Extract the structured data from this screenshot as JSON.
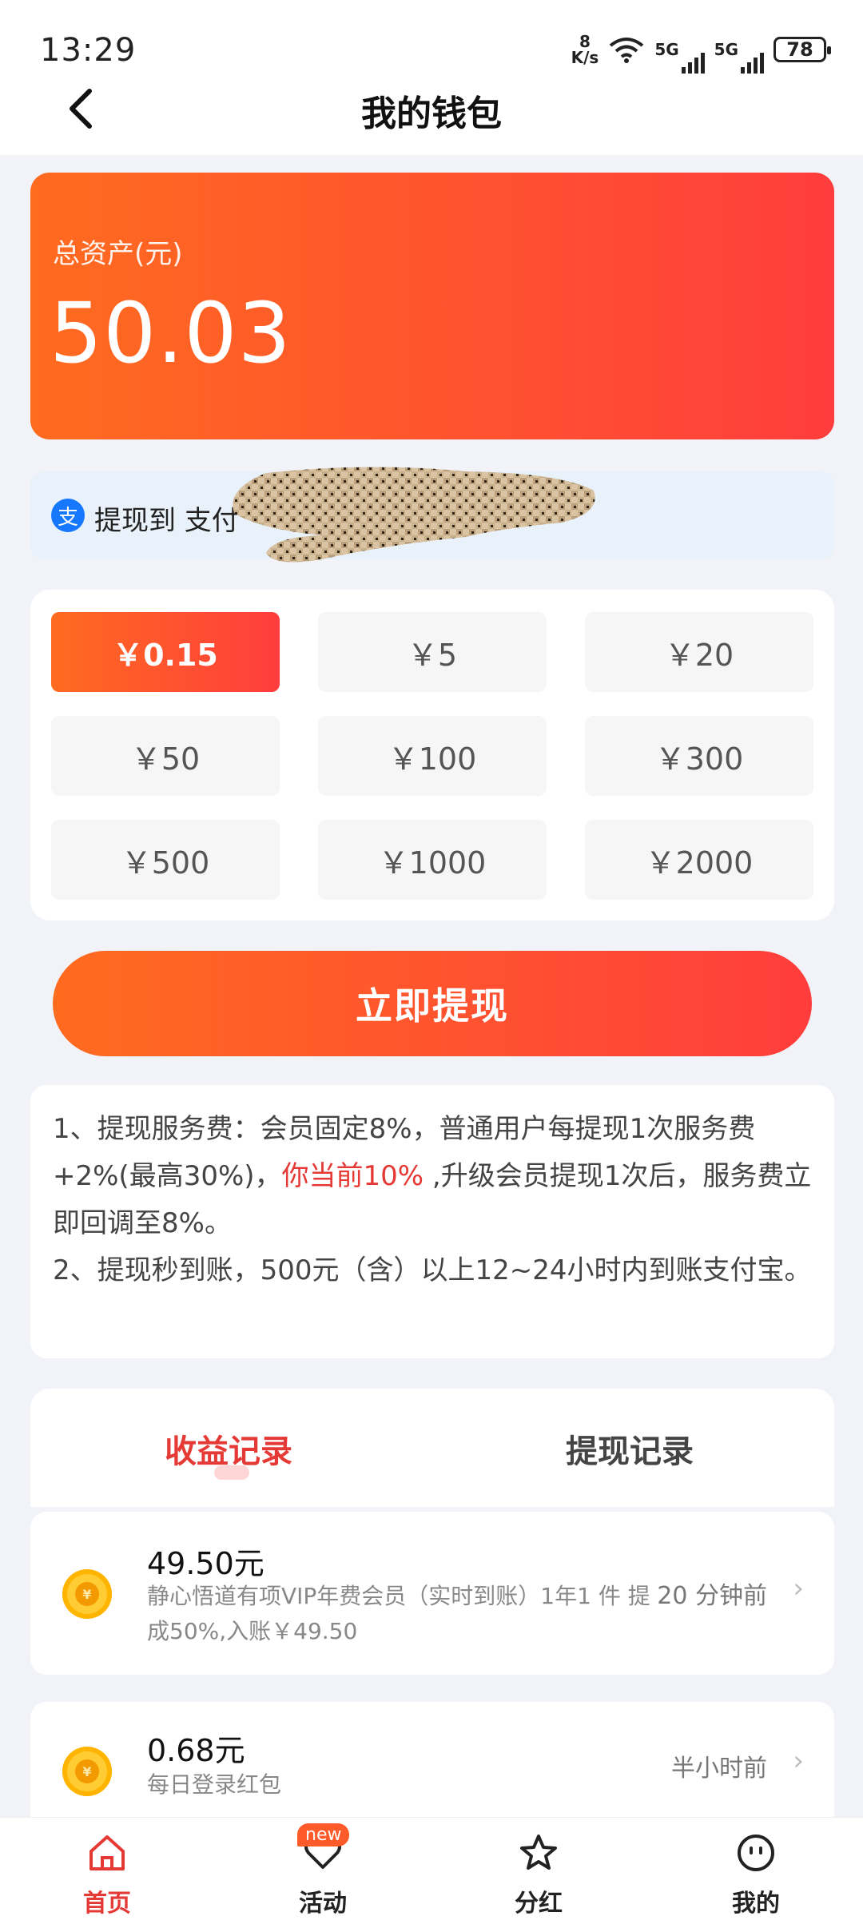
{
  "status": {
    "time": "13:29",
    "net_speed_value": "8",
    "net_speed_unit": "K/s",
    "sig1": "5G",
    "sig2": "5G",
    "battery": "78"
  },
  "header": {
    "title": "我的钱包"
  },
  "asset": {
    "label": "总资产(元)",
    "value": "50.03"
  },
  "withdraw_to": {
    "label": "提现到 支付"
  },
  "amounts": [
    {
      "label": "￥0.15",
      "selected": true
    },
    {
      "label": "￥5",
      "selected": false
    },
    {
      "label": "￥20",
      "selected": false
    },
    {
      "label": "￥50",
      "selected": false
    },
    {
      "label": "￥100",
      "selected": false
    },
    {
      "label": "￥300",
      "selected": false
    },
    {
      "label": "￥500",
      "selected": false
    },
    {
      "label": "￥1000",
      "selected": false
    },
    {
      "label": "￥2000",
      "selected": false
    }
  ],
  "withdraw_button": "立即提现",
  "notes": {
    "line1_a": "1、提现服务费：会员固定8%，普通用户每提现1次服务费+2%(最高30%)，",
    "line1_highlight": "你当前10%",
    "line1_b": " ,升级会员提现1次后，服务费立即回调至8%。",
    "line2": "2、提现秒到账，500元（含）以上12~24小时内到账支付宝。"
  },
  "tabs": {
    "income": "收益记录",
    "withdraw": "提现记录"
  },
  "records": [
    {
      "amount": "49.50元",
      "desc": "静心悟道有项VIP年费会员（实时到账）1年1 件 提成50%,入账￥49.50",
      "time": "20 分钟前"
    },
    {
      "amount": "0.68元",
      "desc": "每日登录红包",
      "time": "半小时前"
    }
  ],
  "nav": {
    "home": "首页",
    "activity": "活动",
    "dividend": "分红",
    "mine": "我的",
    "new_badge": "new"
  },
  "colors": {
    "accent_start": "#ff6b1f",
    "accent_end": "#ff3d3d",
    "highlight": "#e53935",
    "alipay": "#1677ff"
  }
}
